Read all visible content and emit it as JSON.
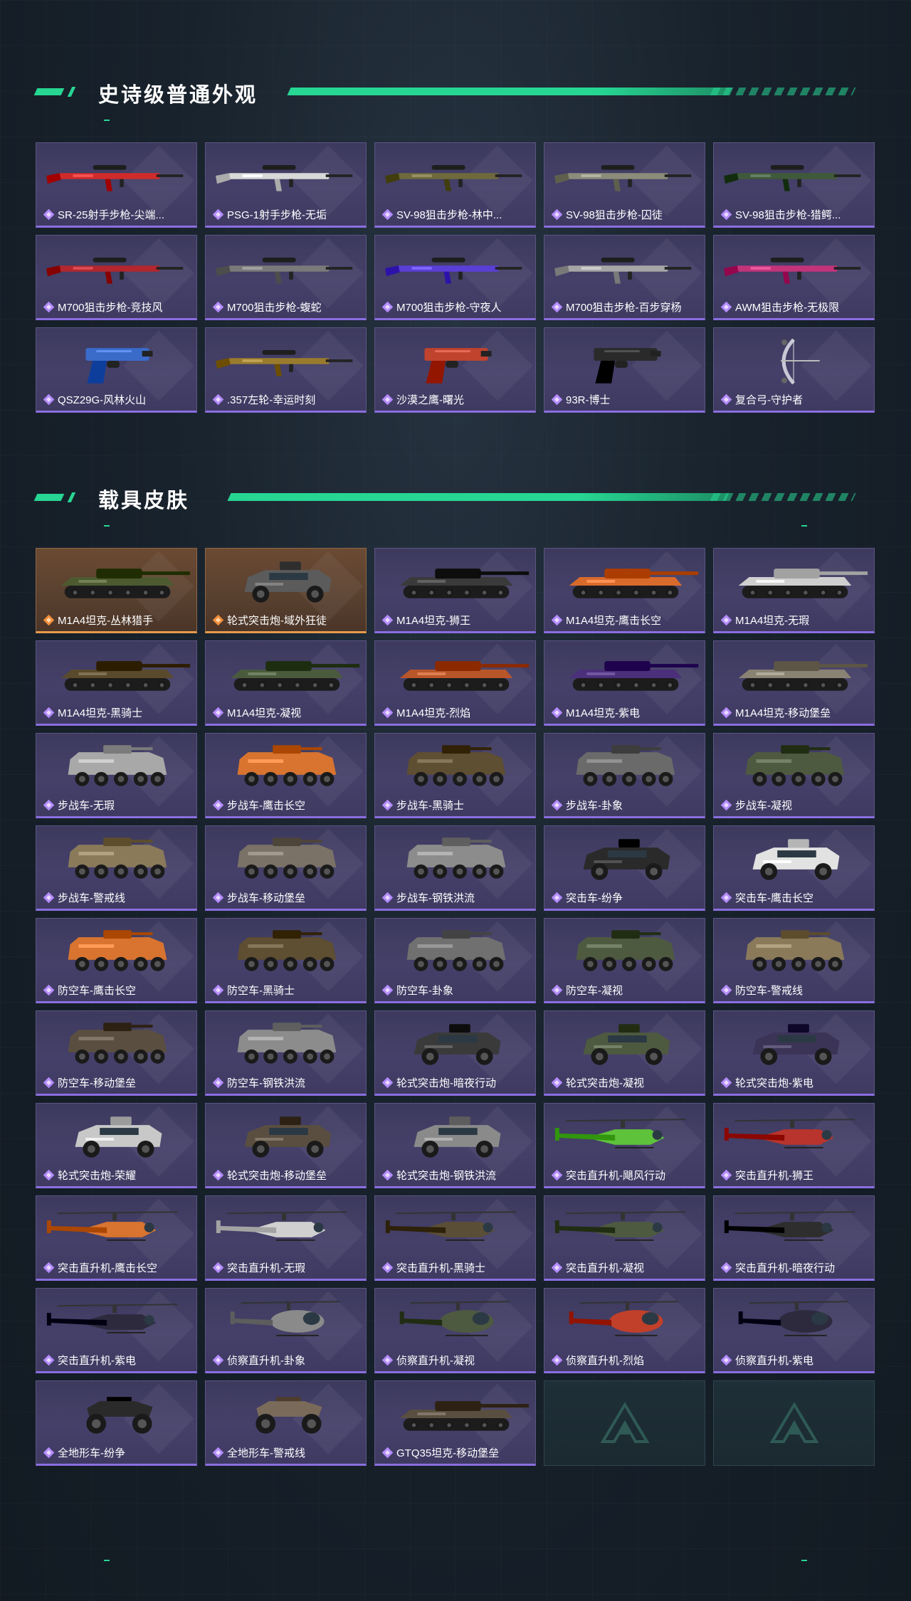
{
  "colors": {
    "accent": "#27d693",
    "epic_purple": "#8a6ee0",
    "legendary_orange": "#e79a4c",
    "card_bg": "#433f66"
  },
  "sections": [
    {
      "title": "史诗级普通外观",
      "items": [
        {
          "name": "SR-25射手步枪-尖端...",
          "kind": "rifle",
          "color": "#cf2b2b",
          "rarity": "epic"
        },
        {
          "name": "PSG-1射手步枪-无垢",
          "kind": "rifle",
          "color": "#d8d8d8",
          "rarity": "epic"
        },
        {
          "name": "SV-98狙击步枪-林中...",
          "kind": "rifle",
          "color": "#6f6a3c",
          "rarity": "epic"
        },
        {
          "name": "SV-98狙击步枪-囚徒",
          "kind": "rifle",
          "color": "#8c8c7a",
          "rarity": "epic"
        },
        {
          "name": "SV-98狙击步枪-猎鳄...",
          "kind": "rifle",
          "color": "#3f5a3a",
          "rarity": "epic"
        },
        {
          "name": "M700狙击步枪-竞技风",
          "kind": "rifle",
          "color": "#b3262d",
          "rarity": "epic"
        },
        {
          "name": "M700狙击步枪-蝮蛇",
          "kind": "rifle",
          "color": "#7a7a7a",
          "rarity": "epic"
        },
        {
          "name": "M700狙击步枪-守夜人",
          "kind": "rifle",
          "color": "#5a3fd6",
          "rarity": "epic"
        },
        {
          "name": "M700狙击步枪-百步穿杨",
          "kind": "rifle",
          "color": "#a6a6a6",
          "rarity": "epic"
        },
        {
          "name": "AWM狙击步枪-无极限",
          "kind": "rifle",
          "color": "#c2337a",
          "rarity": "epic"
        },
        {
          "name": "QSZ29G-风林火山",
          "kind": "pistol",
          "color": "#3a6bc9",
          "rarity": "epic"
        },
        {
          "name": ".357左轮-幸运时刻",
          "kind": "rifle",
          "color": "#9a7b2e",
          "rarity": "epic"
        },
        {
          "name": "沙漠之鹰-曙光",
          "kind": "pistol",
          "color": "#c0432e",
          "rarity": "epic"
        },
        {
          "name": "93R-博士",
          "kind": "pistol",
          "color": "#2a2a2a",
          "rarity": "epic"
        },
        {
          "name": "复合弓-守护者",
          "kind": "bow",
          "color": "#c8c8d6",
          "rarity": "epic"
        }
      ]
    },
    {
      "title": "载具皮肤",
      "items": [
        {
          "name": "M1A4坦克-丛林猎手",
          "kind": "tank",
          "color": "#4d5a30",
          "rarity": "legendary"
        },
        {
          "name": "轮式突击炮-域外狂徒",
          "kind": "car",
          "color": "#5b5b5b",
          "rarity": "legendary"
        },
        {
          "name": "M1A4坦克-狮王",
          "kind": "tank",
          "color": "#3a3a3a",
          "rarity": "epic"
        },
        {
          "name": "M1A4坦克-鹰击长空",
          "kind": "tank",
          "color": "#d86a2c",
          "rarity": "epic"
        },
        {
          "name": "M1A4坦克-无瑕",
          "kind": "tank",
          "color": "#cfcfcf",
          "rarity": "epic"
        },
        {
          "name": "M1A4坦克-黑骑士",
          "kind": "tank",
          "color": "#5a4a2c",
          "rarity": "epic"
        },
        {
          "name": "M1A4坦克-凝视",
          "kind": "tank",
          "color": "#4a5a3c",
          "rarity": "epic"
        },
        {
          "name": "M1A4坦克-烈焰",
          "kind": "tank",
          "color": "#b8562a",
          "rarity": "epic"
        },
        {
          "name": "M1A4坦克-紫电",
          "kind": "tank",
          "color": "#4b2f7a",
          "rarity": "epic"
        },
        {
          "name": "M1A4坦克-移动堡垒",
          "kind": "tank",
          "color": "#8a8272",
          "rarity": "epic"
        },
        {
          "name": "步战车-无瑕",
          "kind": "apc",
          "color": "#a8a8a8",
          "rarity": "epic"
        },
        {
          "name": "步战车-鹰击长空",
          "kind": "apc",
          "color": "#d8742f",
          "rarity": "epic"
        },
        {
          "name": "步战车-黑骑士",
          "kind": "apc",
          "color": "#5e4e32",
          "rarity": "epic"
        },
        {
          "name": "步战车-卦象",
          "kind": "apc",
          "color": "#6a6a6a",
          "rarity": "epic"
        },
        {
          "name": "步战车-凝视",
          "kind": "apc",
          "color": "#4e5a40",
          "rarity": "epic"
        },
        {
          "name": "步战车-警戒线",
          "kind": "apc",
          "color": "#8a7a5a",
          "rarity": "epic"
        },
        {
          "name": "步战车-移动堡垒",
          "kind": "apc",
          "color": "#7a7266",
          "rarity": "epic"
        },
        {
          "name": "步战车-钢铁洪流",
          "kind": "apc",
          "color": "#8c8c8c",
          "rarity": "epic"
        },
        {
          "name": "突击车-纷争",
          "kind": "car",
          "color": "#2a2a2a",
          "rarity": "epic"
        },
        {
          "name": "突击车-鹰击长空",
          "kind": "car",
          "color": "#e2e2e2",
          "rarity": "epic"
        },
        {
          "name": "防空车-鹰击长空",
          "kind": "apc",
          "color": "#d8742f",
          "rarity": "epic"
        },
        {
          "name": "防空车-黑骑士",
          "kind": "apc",
          "color": "#5e4e32",
          "rarity": "epic"
        },
        {
          "name": "防空车-卦象",
          "kind": "apc",
          "color": "#707070",
          "rarity": "epic"
        },
        {
          "name": "防空车-凝视",
          "kind": "apc",
          "color": "#4e5a40",
          "rarity": "epic"
        },
        {
          "name": "防空车-警戒线",
          "kind": "apc",
          "color": "#8a7a5a",
          "rarity": "epic"
        },
        {
          "name": "防空车-移动堡垒",
          "kind": "apc",
          "color": "#5a4e40",
          "rarity": "epic"
        },
        {
          "name": "防空车-钢铁洪流",
          "kind": "apc",
          "color": "#8c8c8c",
          "rarity": "epic"
        },
        {
          "name": "轮式突击炮-暗夜行动",
          "kind": "car",
          "color": "#3a3a3a",
          "rarity": "epic"
        },
        {
          "name": "轮式突击炮-凝视",
          "kind": "car",
          "color": "#4e5a40",
          "rarity": "epic"
        },
        {
          "name": "轮式突击炮-紫电",
          "kind": "car",
          "color": "#3c3456",
          "rarity": "epic"
        },
        {
          "name": "轮式突击炮-荣耀",
          "kind": "car",
          "color": "#c8c8c8",
          "rarity": "epic"
        },
        {
          "name": "轮式突击炮-移动堡垒",
          "kind": "car",
          "color": "#5a4e40",
          "rarity": "epic"
        },
        {
          "name": "轮式突击炮-钢铁洪流",
          "kind": "car",
          "color": "#8a8a8a",
          "rarity": "epic"
        },
        {
          "name": "突击直升机-飓风行动",
          "kind": "heli",
          "color": "#5ec23a",
          "rarity": "epic"
        },
        {
          "name": "突击直升机-狮王",
          "kind": "heli",
          "color": "#b8342c",
          "rarity": "epic"
        },
        {
          "name": "突击直升机-鹰击长空",
          "kind": "heli",
          "color": "#d8742f",
          "rarity": "epic"
        },
        {
          "name": "突击直升机-无瑕",
          "kind": "heli",
          "color": "#d0d0d0",
          "rarity": "epic"
        },
        {
          "name": "突击直升机-黑骑士",
          "kind": "heli",
          "color": "#5a4e36",
          "rarity": "epic"
        },
        {
          "name": "突击直升机-凝视",
          "kind": "heli",
          "color": "#4e5a40",
          "rarity": "epic"
        },
        {
          "name": "突击直升机-暗夜行动",
          "kind": "heli",
          "color": "#2e2e2e",
          "rarity": "epic"
        },
        {
          "name": "突击直升机-紫电",
          "kind": "heli",
          "color": "#2e2a3e",
          "rarity": "epic"
        },
        {
          "name": "侦察直升机-卦象",
          "kind": "scout",
          "color": "#8a8a8a",
          "rarity": "epic"
        },
        {
          "name": "侦察直升机-凝视",
          "kind": "scout",
          "color": "#4e5a40",
          "rarity": "epic"
        },
        {
          "name": "侦察直升机-烈焰",
          "kind": "scout",
          "color": "#c0402a",
          "rarity": "epic"
        },
        {
          "name": "侦察直升机-紫电",
          "kind": "scout",
          "color": "#2e2a3e",
          "rarity": "epic"
        },
        {
          "name": "全地形车-纷争",
          "kind": "atv",
          "color": "#2a2a2a",
          "rarity": "epic"
        },
        {
          "name": "全地形车-警戒线",
          "kind": "atv",
          "color": "#7a6a5a",
          "rarity": "epic"
        },
        {
          "name": "GTQ35坦克-移动堡垒",
          "kind": "tank",
          "color": "#5a4e40",
          "rarity": "epic"
        },
        {
          "name": "",
          "kind": "empty",
          "color": "",
          "rarity": "empty"
        },
        {
          "name": "",
          "kind": "empty",
          "color": "",
          "rarity": "empty"
        }
      ]
    }
  ]
}
